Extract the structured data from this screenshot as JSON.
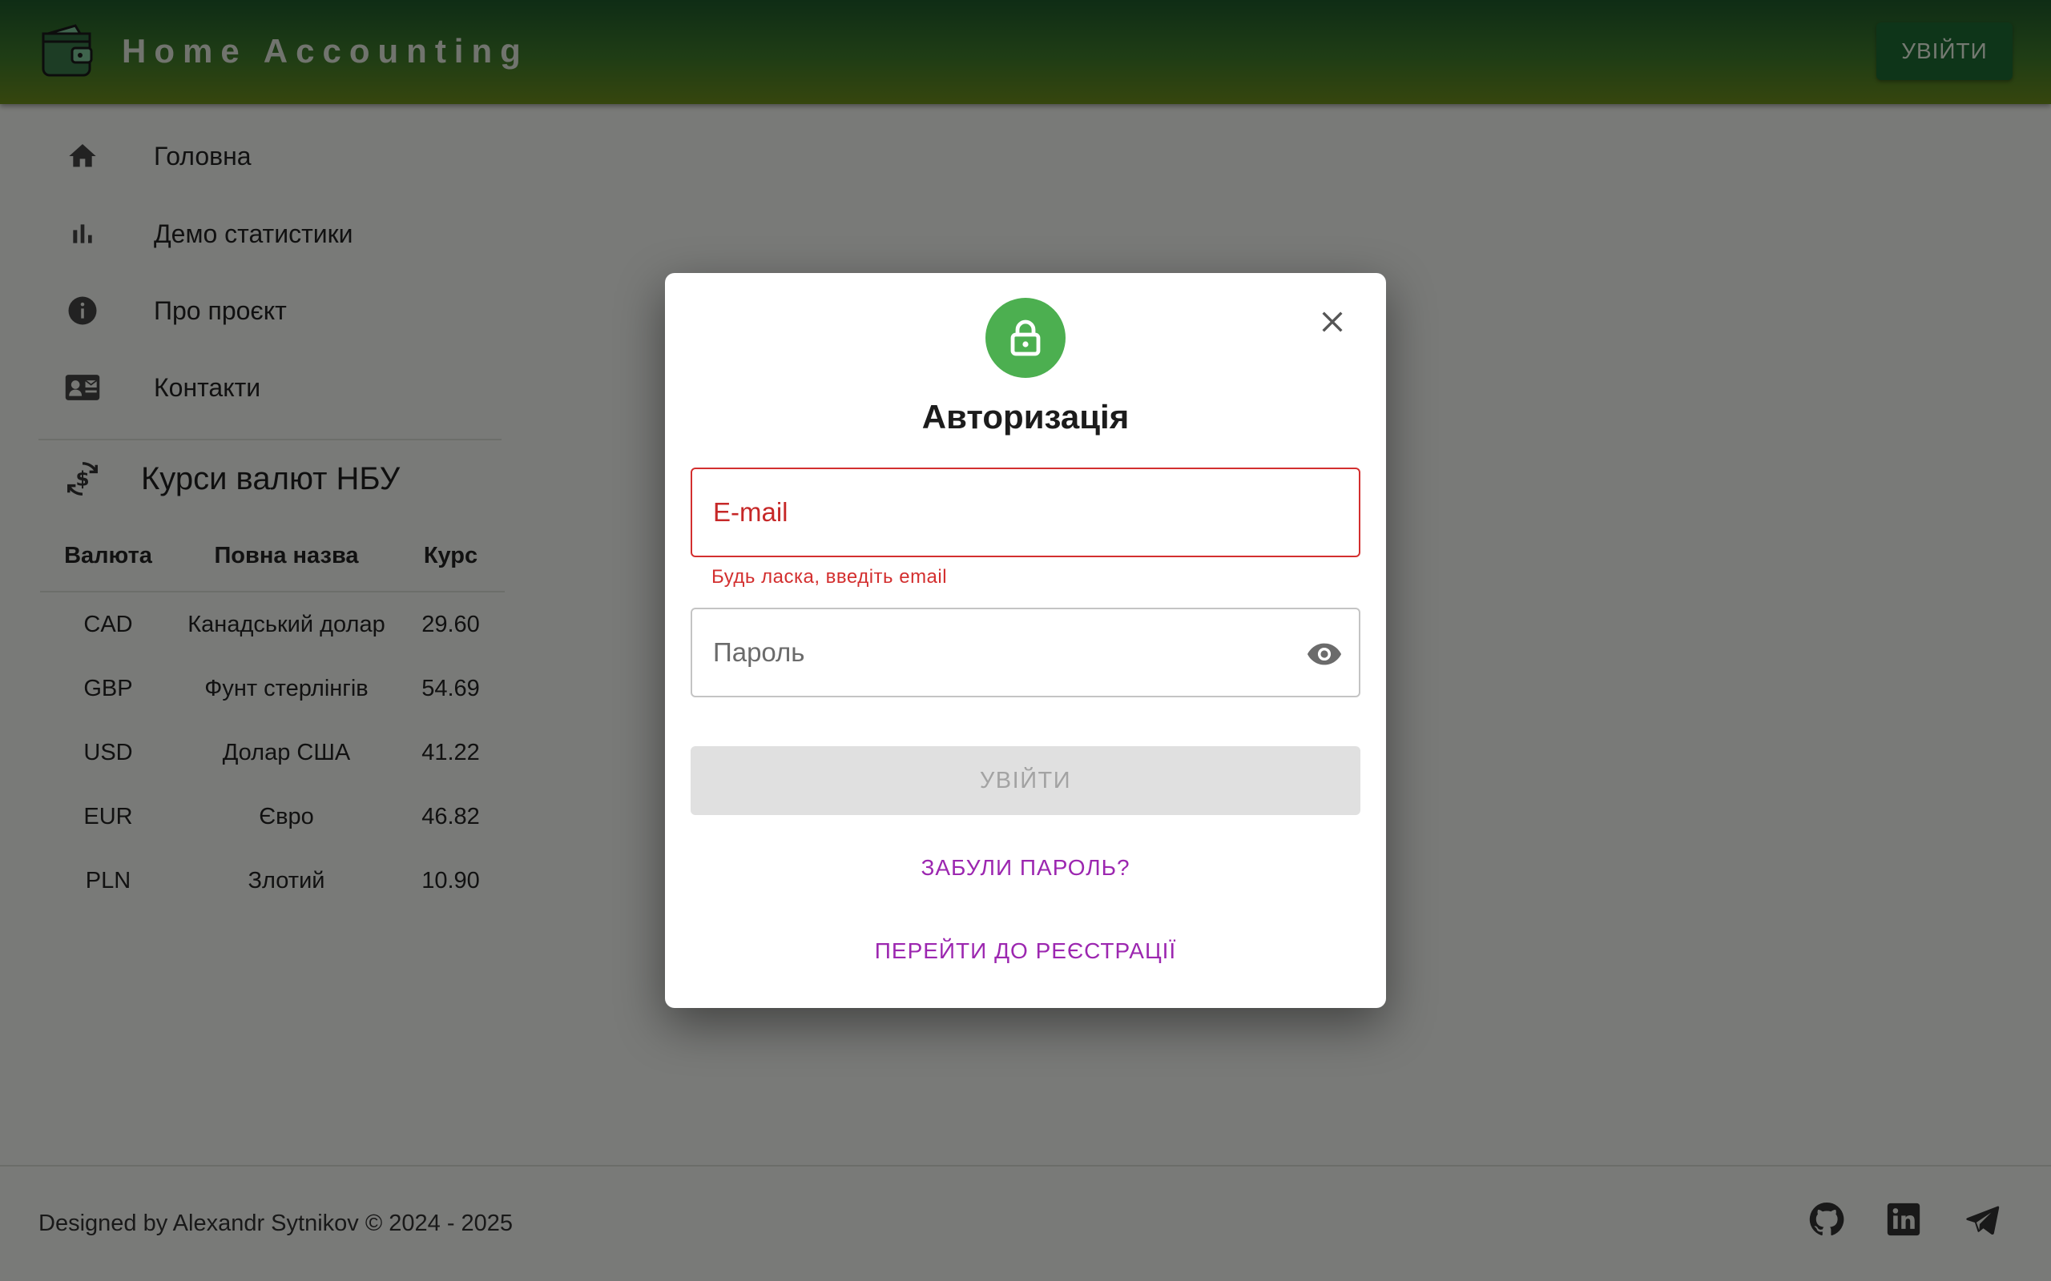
{
  "app": {
    "title": "Home Accounting",
    "login_button": "УВІЙТИ"
  },
  "sidebar": {
    "items": [
      {
        "label": "Головна",
        "icon": "home-icon"
      },
      {
        "label": "Демо статистики",
        "icon": "bar-chart-icon"
      },
      {
        "label": "Про проєкт",
        "icon": "info-icon"
      },
      {
        "label": "Контакти",
        "icon": "contact-card-icon"
      }
    ]
  },
  "rates": {
    "title": "Курси валют НБУ",
    "icon": "currency-exchange-icon",
    "columns": [
      "Валюта",
      "Повна назва",
      "Курс"
    ],
    "rows": [
      {
        "code": "CAD",
        "name": "Канадський долар",
        "rate": "29.60"
      },
      {
        "code": "GBP",
        "name": "Фунт стерлінгів",
        "rate": "54.69"
      },
      {
        "code": "USD",
        "name": "Долар США",
        "rate": "41.22"
      },
      {
        "code": "EUR",
        "name": "Євро",
        "rate": "46.82"
      },
      {
        "code": "PLN",
        "name": "Злотий",
        "rate": "10.90"
      }
    ]
  },
  "footer": {
    "text": "Designed by Alexandr Sytnikov © 2024 - 2025",
    "social": [
      "github-icon",
      "linkedin-icon",
      "telegram-icon"
    ]
  },
  "modal": {
    "title": "Авторизація",
    "icon": "lock-icon",
    "email": {
      "placeholder": "E-mail",
      "value": "",
      "error": "Будь ласка, введіть email"
    },
    "password": {
      "placeholder": "Пароль",
      "value": ""
    },
    "submit_label": "УВІЙТИ",
    "forgot_label": "ЗАБУЛИ ПАРОЛЬ?",
    "register_label": "ПЕРЕЙТИ ДО РЕЄСТРАЦІЇ"
  },
  "colors": {
    "header_gradient_start": "#1e5a2b",
    "header_gradient_end": "#6c8c1c",
    "accent_green": "#4caf50",
    "error": "#d32f2f",
    "link": "#9c27b0"
  }
}
